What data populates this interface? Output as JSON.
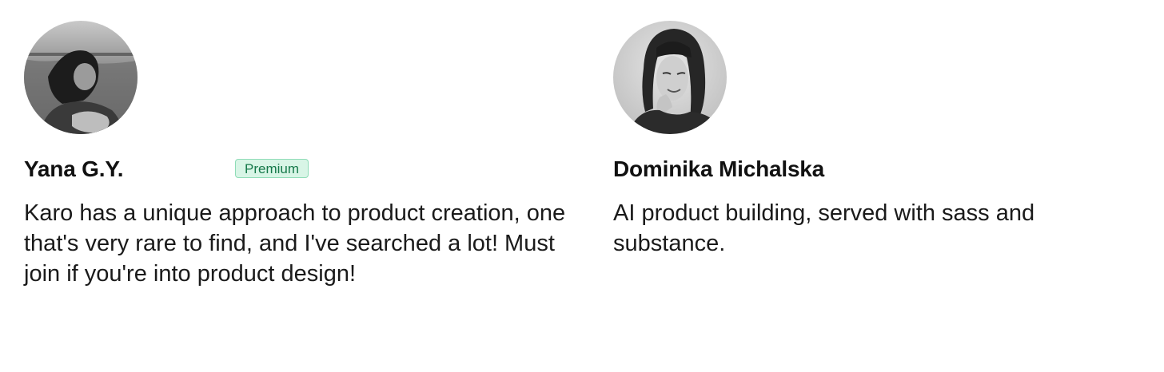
{
  "testimonials": [
    {
      "name": "Yana G.Y.",
      "badge": "Premium",
      "quote": "Karo has a unique approach to product creation, one that's very rare to find, and I've searched a lot! Must join if you're into product design!",
      "avatar": "avatar-photo"
    },
    {
      "name": "Dominika Michalska",
      "quote": "AI product building, served with sass and substance.",
      "avatar": "avatar-photo"
    }
  ],
  "colors": {
    "badge_bg": "#d8f5e6",
    "badge_border": "#8fdcb7",
    "badge_text": "#16794a",
    "text": "#111111"
  }
}
